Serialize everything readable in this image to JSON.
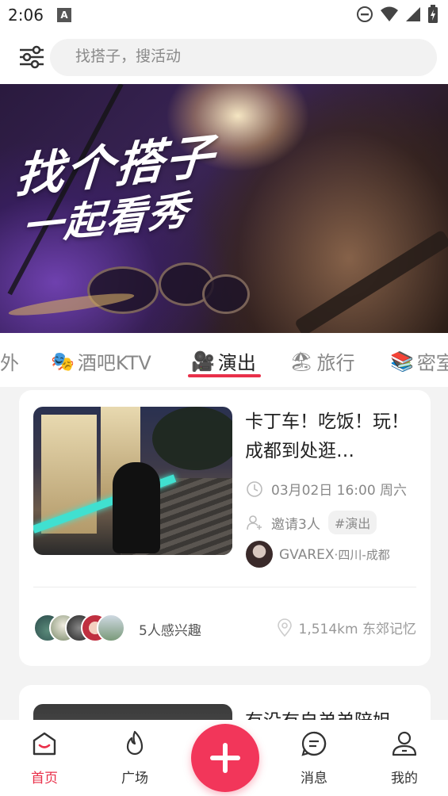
{
  "status_bar": {
    "time": "2:06",
    "notification_icon": "A"
  },
  "header": {
    "search_placeholder": "找搭子，搜活动"
  },
  "banner": {
    "line1": "找个搭子",
    "line2": "一起看秀"
  },
  "categories": [
    {
      "label": "外",
      "icon": ""
    },
    {
      "label": "酒吧KTV",
      "icon": "🎭"
    },
    {
      "label": "演出",
      "icon": "🎥",
      "active": true
    },
    {
      "label": "旅行",
      "icon": "🏖"
    },
    {
      "label": "密室",
      "icon": "📚"
    }
  ],
  "card": {
    "title": "卡丁车！吃饭！玩！成都到处逛…",
    "datetime": "03月02日 16:00 周六",
    "invite": "邀请3人",
    "tag": "#演出",
    "author": "GVAREX",
    "author_location": "·四川-成都",
    "interest_count": "5人感兴趣",
    "distance": "1,514km 东郊记忆"
  },
  "card2": {
    "title": "有没有自弟弟陪姐"
  },
  "nav": {
    "home": "首页",
    "plaza": "广场",
    "messages": "消息",
    "mine": "我的"
  },
  "colors": {
    "accent": "#e9304a",
    "fab": "#f2365a"
  }
}
